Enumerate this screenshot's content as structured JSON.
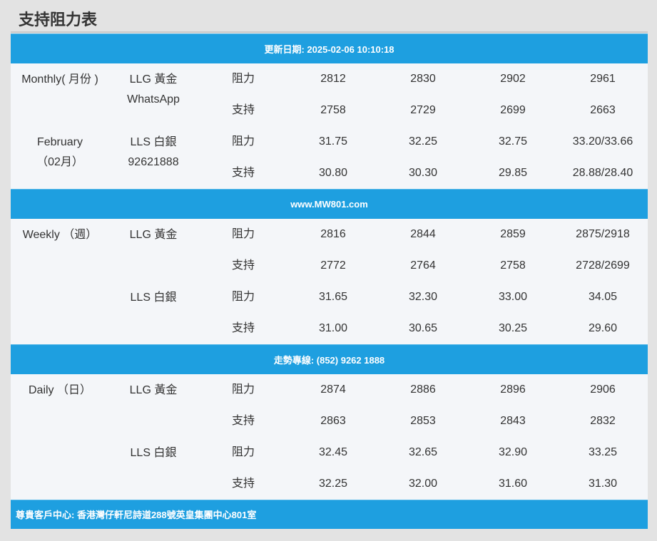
{
  "page_title": "支持阻力表",
  "header_bar": "更新日期: 2025-02-06 10:10:18",
  "middle_bar_1": "www.MW801.com",
  "middle_bar_2": "走勢專線: (852) 9262 1888",
  "footer_bar": "尊貴客戶中心: 香港灣仔軒尼詩道288號英皇集團中心801室",
  "monthly": {
    "period_line1": "Monthly( 月份 )",
    "period_line2": "February",
    "period_line3": "（02月）",
    "llg_label": "LLG 黃金",
    "llg_sub": "WhatsApp",
    "lls_label": "LLS 白銀",
    "lls_sub": "92621888",
    "rows": [
      {
        "type": "阻力",
        "values": [
          "2812",
          "2830",
          "2902",
          "2961"
        ]
      },
      {
        "type": "支持",
        "values": [
          "2758",
          "2729",
          "2699",
          "2663"
        ]
      },
      {
        "type": "阻力",
        "values": [
          "31.75",
          "32.25",
          "32.75",
          "33.20/33.66"
        ]
      },
      {
        "type": "支持",
        "values": [
          "30.80",
          "30.30",
          "29.85",
          "28.88/28.40"
        ]
      }
    ]
  },
  "weekly": {
    "period": "Weekly （週）",
    "llg_label": "LLG 黃金",
    "lls_label": "LLS 白銀",
    "rows": [
      {
        "type": "阻力",
        "values": [
          "2816",
          "2844",
          "2859",
          "2875/2918"
        ]
      },
      {
        "type": "支持",
        "values": [
          "2772",
          "2764",
          "2758",
          "2728/2699"
        ]
      },
      {
        "type": "阻力",
        "values": [
          "31.65",
          "32.30",
          "33.00",
          "34.05"
        ]
      },
      {
        "type": "支持",
        "values": [
          "31.00",
          "30.65",
          "30.25",
          "29.60"
        ]
      }
    ]
  },
  "daily": {
    "period": "Daily （日）",
    "llg_label": "LLG 黃金",
    "lls_label": "LLS 白銀",
    "rows": [
      {
        "type": "阻力",
        "values": [
          "2874",
          "2886",
          "2896",
          "2906"
        ]
      },
      {
        "type": "支持",
        "values": [
          "2863",
          "2853",
          "2843",
          "2832"
        ]
      },
      {
        "type": "阻力",
        "values": [
          "32.45",
          "32.65",
          "32.90",
          "33.25"
        ]
      },
      {
        "type": "支持",
        "values": [
          "32.25",
          "32.00",
          "31.60",
          "31.30"
        ]
      }
    ]
  },
  "colors": {
    "bar_blue": "#1e9fe0",
    "panel_bg": "#f4f6f9",
    "page_bg": "#e3e3e3"
  }
}
